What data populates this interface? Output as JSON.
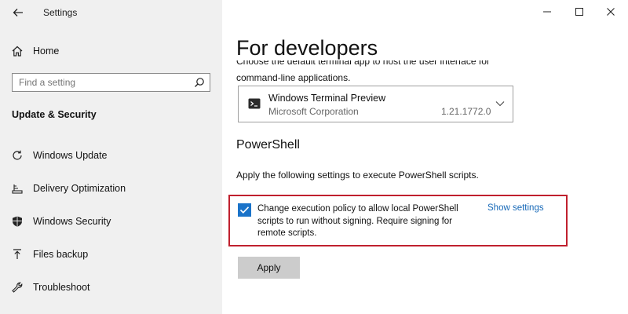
{
  "window": {
    "title": "Settings",
    "minimize_label": "—",
    "maximize_label": "☐",
    "close_label": "✕"
  },
  "sidebar": {
    "home_label": "Home",
    "search_placeholder": "Find a setting",
    "section_title": "Update & Security",
    "items": [
      {
        "label": "Windows Update",
        "icon": "refresh-icon"
      },
      {
        "label": "Delivery Optimization",
        "icon": "delivery-optimization-icon"
      },
      {
        "label": "Windows Security",
        "icon": "shield-icon"
      },
      {
        "label": "Files backup",
        "icon": "upload-arrow-icon"
      },
      {
        "label": "Troubleshoot",
        "icon": "wrench-icon"
      }
    ]
  },
  "main": {
    "page_title": "For developers",
    "desc_cut": "Choose the default terminal app to host the user interface for",
    "desc_line2": "command-line applications.",
    "terminal_dropdown": {
      "app_name": "Windows Terminal Preview",
      "publisher": "Microsoft Corporation",
      "version": "1.21.1772.0"
    },
    "powershell": {
      "heading": "PowerShell",
      "description": "Apply the following settings to execute PowerShell scripts.",
      "checkbox_checked": true,
      "checkbox_label": "Change execution policy to allow local PowerShell scripts to run without signing. Require signing for remote scripts.",
      "show_settings_link": "Show settings",
      "apply_button": "Apply"
    }
  },
  "colors": {
    "accent": "#1a73c9",
    "link": "#1769b8",
    "highlight_border": "#c0202e",
    "sidebar_bg": "#f0f0f0"
  }
}
